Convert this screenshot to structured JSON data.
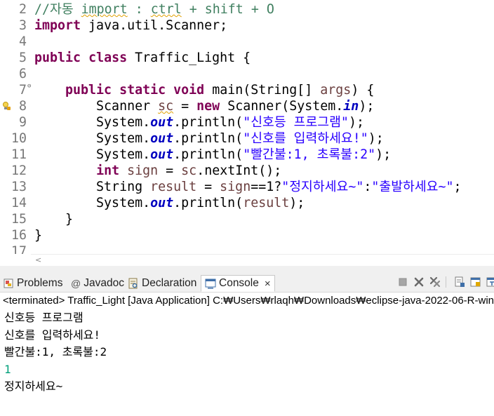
{
  "editor": {
    "lines": [
      {
        "num": "2",
        "tokens": [
          {
            "t": "//자동 ",
            "c": "cm"
          },
          {
            "t": "import",
            "c": "cm squiggle"
          },
          {
            "t": " : ",
            "c": "cm"
          },
          {
            "t": "ctrl",
            "c": "cm squiggle"
          },
          {
            "t": " + shift + O",
            "c": "cm"
          }
        ]
      },
      {
        "num": "3",
        "tokens": [
          {
            "t": "import",
            "c": "kw"
          },
          {
            "t": " java.util.Scanner;",
            "c": ""
          }
        ]
      },
      {
        "num": "4",
        "tokens": []
      },
      {
        "num": "5",
        "tokens": [
          {
            "t": "public",
            "c": "kw"
          },
          {
            "t": " ",
            "c": ""
          },
          {
            "t": "class",
            "c": "kw"
          },
          {
            "t": " Traffic_Light {",
            "c": ""
          }
        ]
      },
      {
        "num": "6",
        "tokens": []
      },
      {
        "num": "7",
        "fold": "⊖",
        "tokens": [
          {
            "t": "    ",
            "c": ""
          },
          {
            "t": "public",
            "c": "kw"
          },
          {
            "t": " ",
            "c": ""
          },
          {
            "t": "static",
            "c": "kw"
          },
          {
            "t": " ",
            "c": ""
          },
          {
            "t": "void",
            "c": "kw"
          },
          {
            "t": " main(String[] ",
            "c": ""
          },
          {
            "t": "args",
            "c": "vr"
          },
          {
            "t": ") {",
            "c": ""
          }
        ]
      },
      {
        "num": "8",
        "marker": "warning-bulb",
        "tokens": [
          {
            "t": "        Scanner ",
            "c": ""
          },
          {
            "t": "sc",
            "c": "vr squiggle"
          },
          {
            "t": " = ",
            "c": ""
          },
          {
            "t": "new",
            "c": "kw"
          },
          {
            "t": " Scanner(System.",
            "c": ""
          },
          {
            "t": "in",
            "c": "fs"
          },
          {
            "t": ");",
            "c": ""
          }
        ]
      },
      {
        "num": "9",
        "tokens": [
          {
            "t": "        System.",
            "c": ""
          },
          {
            "t": "out",
            "c": "fs"
          },
          {
            "t": ".println(",
            "c": ""
          },
          {
            "t": "\"신호등 프로그램\"",
            "c": "st"
          },
          {
            "t": ");",
            "c": ""
          }
        ]
      },
      {
        "num": "10",
        "tokens": [
          {
            "t": "        System.",
            "c": ""
          },
          {
            "t": "out",
            "c": "fs"
          },
          {
            "t": ".println(",
            "c": ""
          },
          {
            "t": "\"신호를 입력하세요!\"",
            "c": "st"
          },
          {
            "t": ");",
            "c": ""
          }
        ]
      },
      {
        "num": "11",
        "tokens": [
          {
            "t": "        System.",
            "c": ""
          },
          {
            "t": "out",
            "c": "fs"
          },
          {
            "t": ".println(",
            "c": ""
          },
          {
            "t": "\"빨간불:1, 초록불:2\"",
            "c": "st"
          },
          {
            "t": ");",
            "c": ""
          }
        ]
      },
      {
        "num": "12",
        "tokens": [
          {
            "t": "        ",
            "c": ""
          },
          {
            "t": "int",
            "c": "kw"
          },
          {
            "t": " ",
            "c": ""
          },
          {
            "t": "sign",
            "c": "vr"
          },
          {
            "t": " = ",
            "c": ""
          },
          {
            "t": "sc",
            "c": "vr"
          },
          {
            "t": ".nextInt();",
            "c": ""
          }
        ]
      },
      {
        "num": "13",
        "tokens": [
          {
            "t": "        String ",
            "c": ""
          },
          {
            "t": "result",
            "c": "vr"
          },
          {
            "t": " = ",
            "c": ""
          },
          {
            "t": "sign",
            "c": "vr"
          },
          {
            "t": "==1?",
            "c": ""
          },
          {
            "t": "\"정지하세요~\"",
            "c": "st"
          },
          {
            "t": ":",
            "c": ""
          },
          {
            "t": "\"출발하세요~\"",
            "c": "st"
          },
          {
            "t": ";",
            "c": ""
          }
        ]
      },
      {
        "num": "14",
        "tokens": [
          {
            "t": "        System.",
            "c": ""
          },
          {
            "t": "out",
            "c": "fs"
          },
          {
            "t": ".println(",
            "c": ""
          },
          {
            "t": "result",
            "c": "vr"
          },
          {
            "t": ");",
            "c": ""
          }
        ]
      },
      {
        "num": "15",
        "tokens": [
          {
            "t": "    }",
            "c": ""
          }
        ]
      },
      {
        "num": "16",
        "tokens": [
          {
            "t": "}",
            "c": ""
          }
        ]
      },
      {
        "num": "17",
        "tokens": []
      }
    ]
  },
  "scrollbar": {
    "left_arrow": "<"
  },
  "panel": {
    "tabs": [
      {
        "label": "Problems",
        "icon": "problems-icon"
      },
      {
        "label": "Javadoc",
        "icon": "javadoc-icon",
        "glyph": "@"
      },
      {
        "label": "Declaration",
        "icon": "declaration-icon"
      },
      {
        "label": "Console",
        "icon": "console-icon",
        "active": true,
        "close": "×"
      }
    ],
    "toolbar_icons": [
      "terminate-icon",
      "remove-launch-icon",
      "remove-all-terminated-icon",
      "scroll-lock-icon",
      "show-console-icon",
      "pin-console-icon"
    ],
    "colors": {
      "accent": "#5b9bd5",
      "terminate": "#a0a0a0",
      "stdin": "#00a07a"
    }
  },
  "console": {
    "header": "<terminated> Traffic_Light [Java Application] C:₩Users₩rlaqh₩Downloads₩eclipse-java-2022-06-R-win",
    "output": [
      {
        "text": "신호등 프로그램",
        "kind": "stdout"
      },
      {
        "text": "신호를 입력하세요!",
        "kind": "stdout"
      },
      {
        "text": "빨간불:1, 초록불:2",
        "kind": "stdout"
      },
      {
        "text": "1",
        "kind": "stdin"
      },
      {
        "text": "정지하세요~",
        "kind": "stdout"
      }
    ]
  }
}
